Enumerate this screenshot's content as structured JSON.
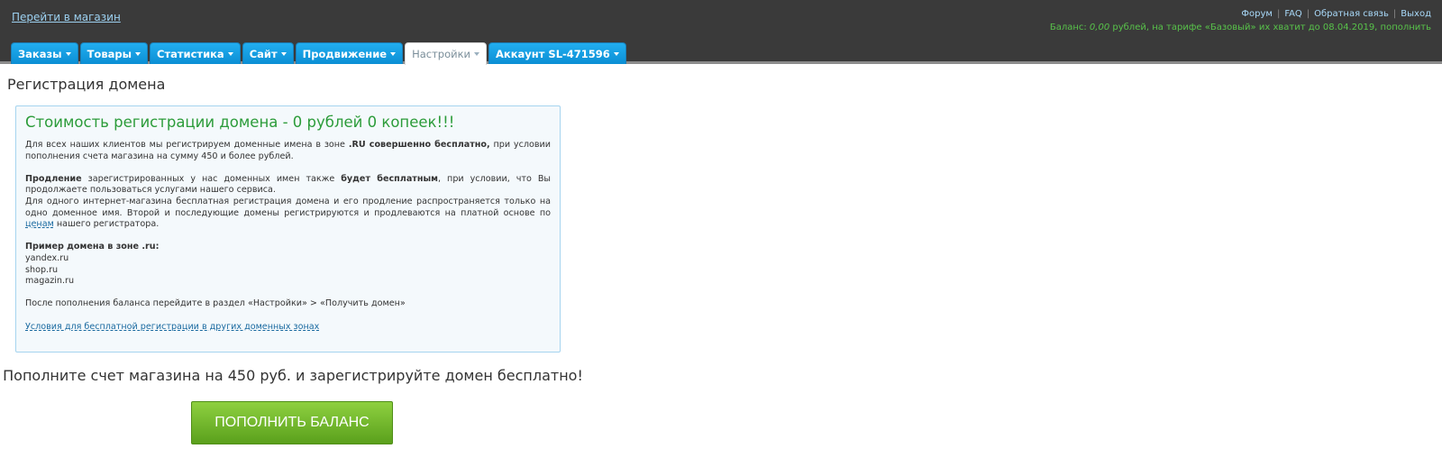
{
  "header": {
    "store_link": "Перейти в магазин",
    "links": [
      "Форум",
      "FAQ",
      "Обратная связь",
      "Выход"
    ],
    "balance": {
      "prefix": "Баланс: ",
      "amount": "0,00",
      "suffix": " рублей, на тарифе «Базовый» их хватит до 08.04.2019, пополнить"
    }
  },
  "tabs": [
    {
      "label": "Заказы",
      "active": false
    },
    {
      "label": "Товары",
      "active": false
    },
    {
      "label": "Статистика",
      "active": false
    },
    {
      "label": "Сайт",
      "active": false
    },
    {
      "label": "Продвижение",
      "active": false
    },
    {
      "label": "Настройки",
      "active": true
    },
    {
      "label": "Аккаунт SL-471596",
      "active": false
    }
  ],
  "page": {
    "title": "Регистрация домена"
  },
  "info": {
    "title": "Стоимость регистрации домена - 0 рублей 0 копеек!!!",
    "p1_a": "Для всех наших клиентов мы регистрируем доменные имена в зоне ",
    "p1_b": ".RU совершенно бесплатно,",
    "p1_c": " при условии пополнения счета магазина на сумму 450 и более рублей.",
    "p2_a": "Продление",
    "p2_b": " зарегистрированных у нас доменных имен также ",
    "p2_c": "будет бесплатным",
    "p2_d": ", при условии, что Вы продолжаете пользоваться услугами нашего сервиса.",
    "p3_a": "Для одного интернет-магазина бесплатная регистрация домена и его продление распространяется только на одно доменное имя. Второй и последующие домены регистрируются и продлеваются на платной основе по ",
    "p3_link": "ценам",
    "p3_b": " нашего регистратора.",
    "example_a": "Пример домена в зоне ",
    "example_b": ".ru",
    "example_c": ":",
    "examples": [
      "yandex.ru",
      "shop.ru",
      "magazin.ru"
    ],
    "after_text": "После пополнения баланса перейдите в раздел «Настройки» > «Получить домен»",
    "conditions_link": "Условия для бесплатной регистрации в других доменных зонах"
  },
  "promo": {
    "text": "Пополните счет магазина на 450 руб. и зарегистрируйте домен бесплатно!",
    "button": "ПОПОЛНИТЬ БАЛАНС"
  }
}
